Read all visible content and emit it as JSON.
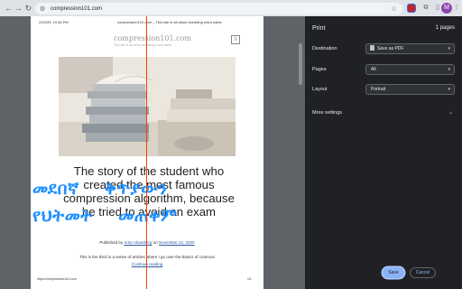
{
  "browser": {
    "url": "compression101.com",
    "icons": {
      "back": "arrow-left-icon",
      "forward": "arrow-right-icon",
      "reload": "reload-icon",
      "star": "star-icon",
      "menu": "kebab-menu-icon"
    },
    "avatar_letter": "M"
  },
  "page": {
    "header_date": "2/20/25, 10:46 PM",
    "header_title": "compression101.com – This site is all about shedding extra bytes",
    "site_title": "compression101.com",
    "site_tagline": "This site is all about shedding extra bytes",
    "article_title": "The story of the student who created the most famous compression algorithm, because he tried to avoid an exam",
    "byline_prefix": "Published by",
    "author": "Artur Akamberg",
    "byline_on": "on",
    "date": "November 22, 2020",
    "excerpt": "This is the third in a series of articles where I go over the basics of common",
    "continue_reading": "Continue reading",
    "footer_url": "https://compression101.com",
    "footer_page": "1/1"
  },
  "translation_overlay": {
    "text": "መደበኛ    ቅጥያውን\nየህትመት    መጠቀም",
    "color": "#1e90ff"
  },
  "print_panel": {
    "title": "Print",
    "page_count": "1 pages",
    "destination_label": "Destination",
    "destination_value": "Save as PDF",
    "pages_label": "Pages",
    "pages_value": "All",
    "layout_label": "Layout",
    "layout_value": "Portrait",
    "more_settings": "More settings",
    "save_button": "Save",
    "cancel_button": "Cancel",
    "accent_color": "#8ab4f8"
  }
}
